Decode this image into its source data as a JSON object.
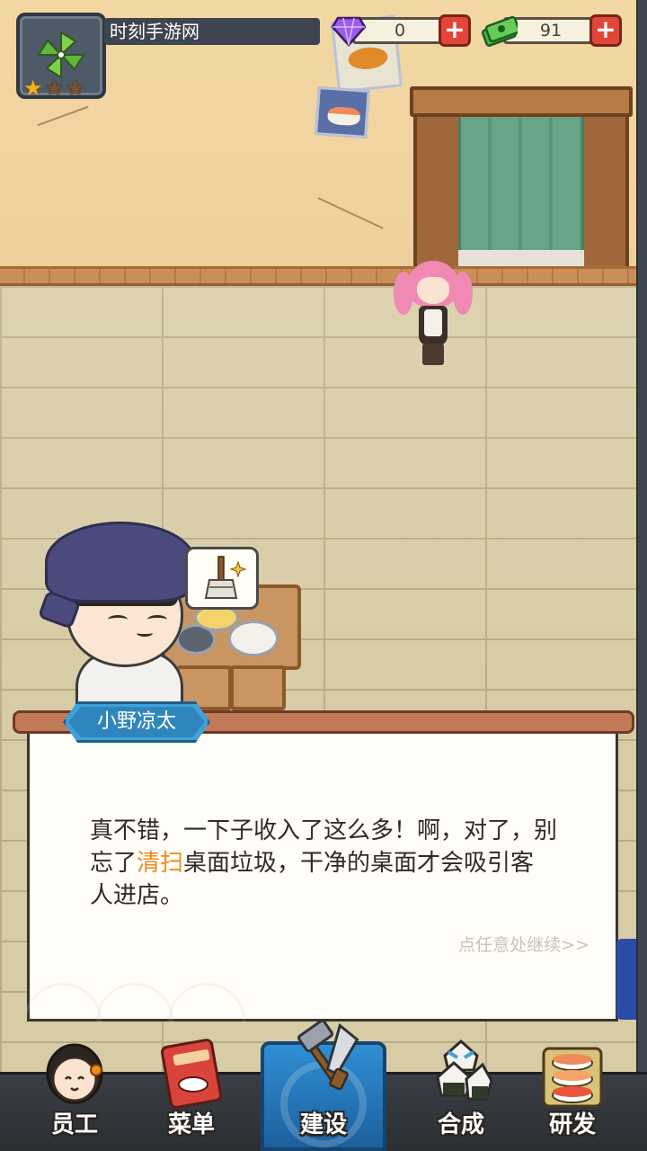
{
  "hud": {
    "player_name": "时刻手游网",
    "avatar_icon": "pinwheel-icon",
    "stars": {
      "filled": 1,
      "total": 3
    },
    "gems": {
      "value": "0",
      "icon": "purple-gem-icon",
      "add_label": "+"
    },
    "cash": {
      "value": "91",
      "icon": "cash-stack-icon",
      "add_label": "+"
    }
  },
  "dialog": {
    "speaker": "小野凉太",
    "text_before": "真不错，一下子收入了这么多！啊，对了，别忘了",
    "text_highlight": "清扫",
    "text_after": "桌面垃圾，干净的桌面才会吸引客人进店。",
    "continue_hint": "点任意处继续>>",
    "highlight_color": "#f08a1c"
  },
  "speech_bubble": {
    "icon": "broom-sparkle-icon"
  },
  "nav": {
    "active": "build",
    "items": [
      {
        "id": "staff",
        "label": "员工",
        "icon": "staff-portrait-icon"
      },
      {
        "id": "menu",
        "label": "菜单",
        "icon": "menu-book-icon"
      },
      {
        "id": "build",
        "label": "建设",
        "icon": "hammer-saw-icon"
      },
      {
        "id": "combine",
        "label": "合成",
        "icon": "rice-ball-merge-icon"
      },
      {
        "id": "research",
        "label": "研发",
        "icon": "sushi-plate-icon"
      }
    ],
    "active_color": "#2f8fd3"
  }
}
